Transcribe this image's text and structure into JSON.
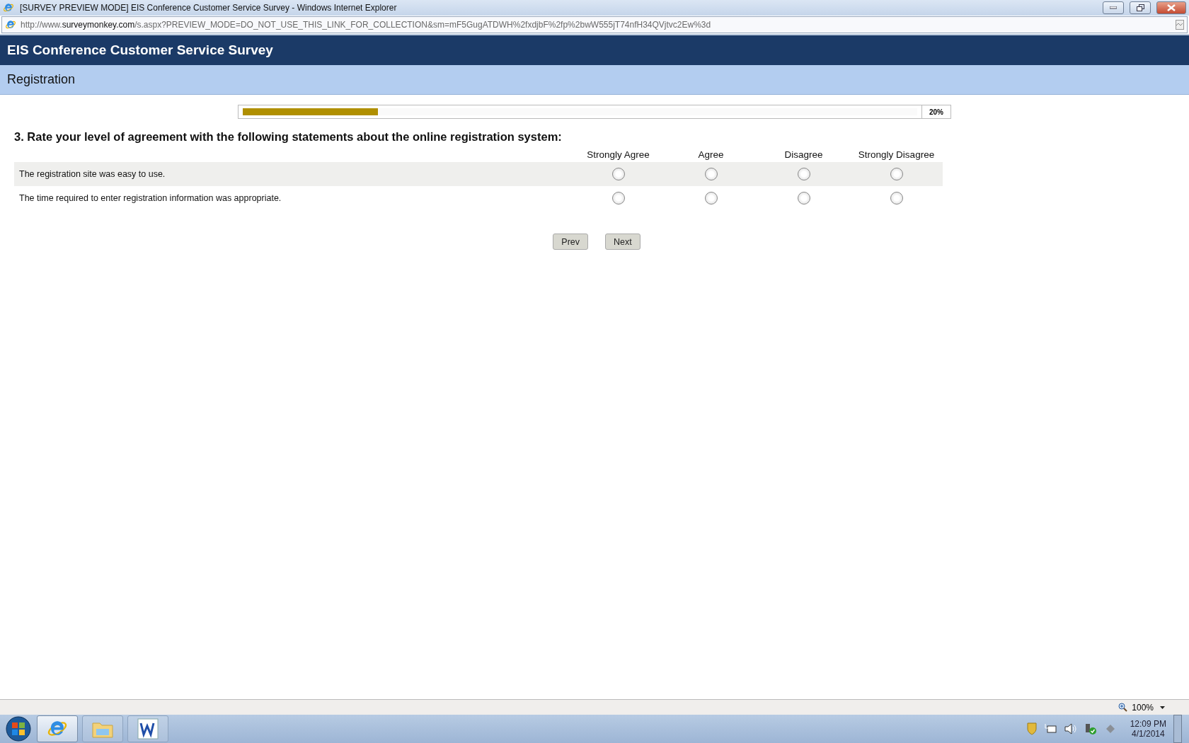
{
  "window": {
    "title": "[SURVEY PREVIEW MODE] EIS Conference Customer Service Survey - Windows Internet Explorer"
  },
  "address": {
    "parts": [
      {
        "text": "http://www.",
        "strong": false
      },
      {
        "text": "surveymonkey.com",
        "strong": true
      },
      {
        "text": "/s.aspx?PREVIEW_MODE=DO_NOT_USE_THIS_LINK_FOR_COLLECTION&sm=mF5GugATDWH%2fxdjbF%2fp%2bwW555jT74nfH34QVjtvc2Ew%3d",
        "strong": false
      }
    ]
  },
  "survey": {
    "title": "EIS Conference Customer Service Survey",
    "page_title": "Registration",
    "progress": {
      "level": 0.2,
      "label": "20%"
    },
    "question": "3. Rate your level of agreement with the following statements about the online registration system:",
    "columns": [
      "Strongly Agree",
      "Agree",
      "Disagree",
      "Strongly Disagree"
    ],
    "rows": [
      {
        "statement": "The registration site was easy to use.",
        "shaded": true,
        "choices": [
          {
            "selected": false
          },
          {
            "selected": false
          },
          {
            "selected": false
          },
          {
            "selected": false
          }
        ]
      },
      {
        "statement": "The time required to enter registration information was appropriate.",
        "shaded": false,
        "choices": [
          {
            "selected": false
          },
          {
            "selected": false
          },
          {
            "selected": false
          },
          {
            "selected": false
          }
        ]
      }
    ],
    "buttons": [
      "Prev",
      "Next"
    ]
  },
  "status_bar": {
    "zoom": "100%"
  },
  "taskbar": {
    "apps": [
      {
        "kind": "ie",
        "selected": true
      },
      {
        "kind": "folder",
        "selected": false
      },
      {
        "kind": "word",
        "selected": false
      }
    ],
    "time": "12:09 PM",
    "date": "4/1/2014"
  }
}
